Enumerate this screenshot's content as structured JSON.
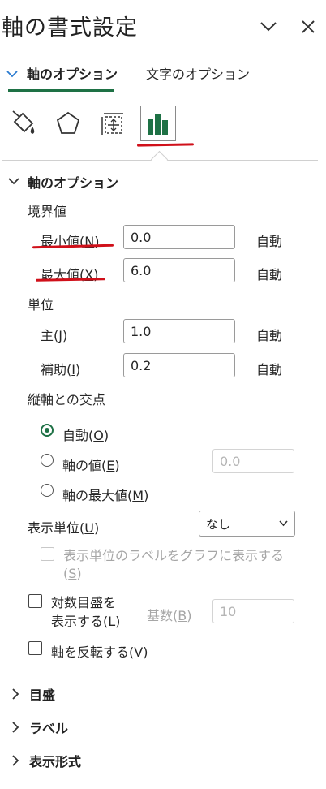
{
  "header": {
    "title": "軸の書式設定",
    "chevron_icon": "chevron-down-icon",
    "close_icon": "close-icon"
  },
  "tabs": {
    "axis_options": "軸のオプション",
    "text_options": "文字のオプション"
  },
  "icon_tabs": [
    "fill-line-icon",
    "effects-pentagon-icon",
    "size-properties-icon",
    "axis-options-chart-icon"
  ],
  "colors": {
    "accent": "#1e7145",
    "annotation": "#d0101a"
  },
  "section": {
    "title": "軸のオプション",
    "bounds": {
      "label": "境界値",
      "min": {
        "label": "最小値(",
        "key": "N",
        "label_end": ")",
        "value": "0.0",
        "auto": "自動"
      },
      "max": {
        "label": "最大値(",
        "key": "X",
        "label_end": ")",
        "value": "6.0",
        "auto": "自動"
      }
    },
    "units": {
      "label": "単位",
      "major": {
        "label": "主(",
        "key": "J",
        "label_end": ")",
        "value": "1.0",
        "auto": "自動"
      },
      "minor": {
        "label": "補助(",
        "key": "I",
        "label_end": ")",
        "value": "0.2",
        "auto": "自動"
      }
    },
    "crosses": {
      "label": "縦軸との交点",
      "auto": {
        "label": "自動(",
        "key": "O",
        "label_end": ")"
      },
      "value": {
        "label": "軸の値(",
        "key": "E",
        "label_end": ")",
        "input": "0.0"
      },
      "max": {
        "label": "軸の最大値(",
        "key": "M",
        "label_end": ")"
      }
    },
    "display_units": {
      "label": "表示単位(",
      "key": "U",
      "label_end": ")",
      "value": "なし"
    },
    "show_units_label": {
      "line1": "表示単位のラベルをグラフに表示する",
      "key": "S"
    },
    "log_scale": {
      "line1": "対数目盛を",
      "line2": "表示する(",
      "key": "L",
      "label_end": ")",
      "base_label": "基数(",
      "base_key": "B",
      "base_end": ")",
      "base_value": "10"
    },
    "reverse": {
      "label": "軸を反転する(",
      "key": "V",
      "label_end": ")"
    }
  },
  "collapsed_sections": [
    "目盛",
    "ラベル",
    "表示形式"
  ]
}
